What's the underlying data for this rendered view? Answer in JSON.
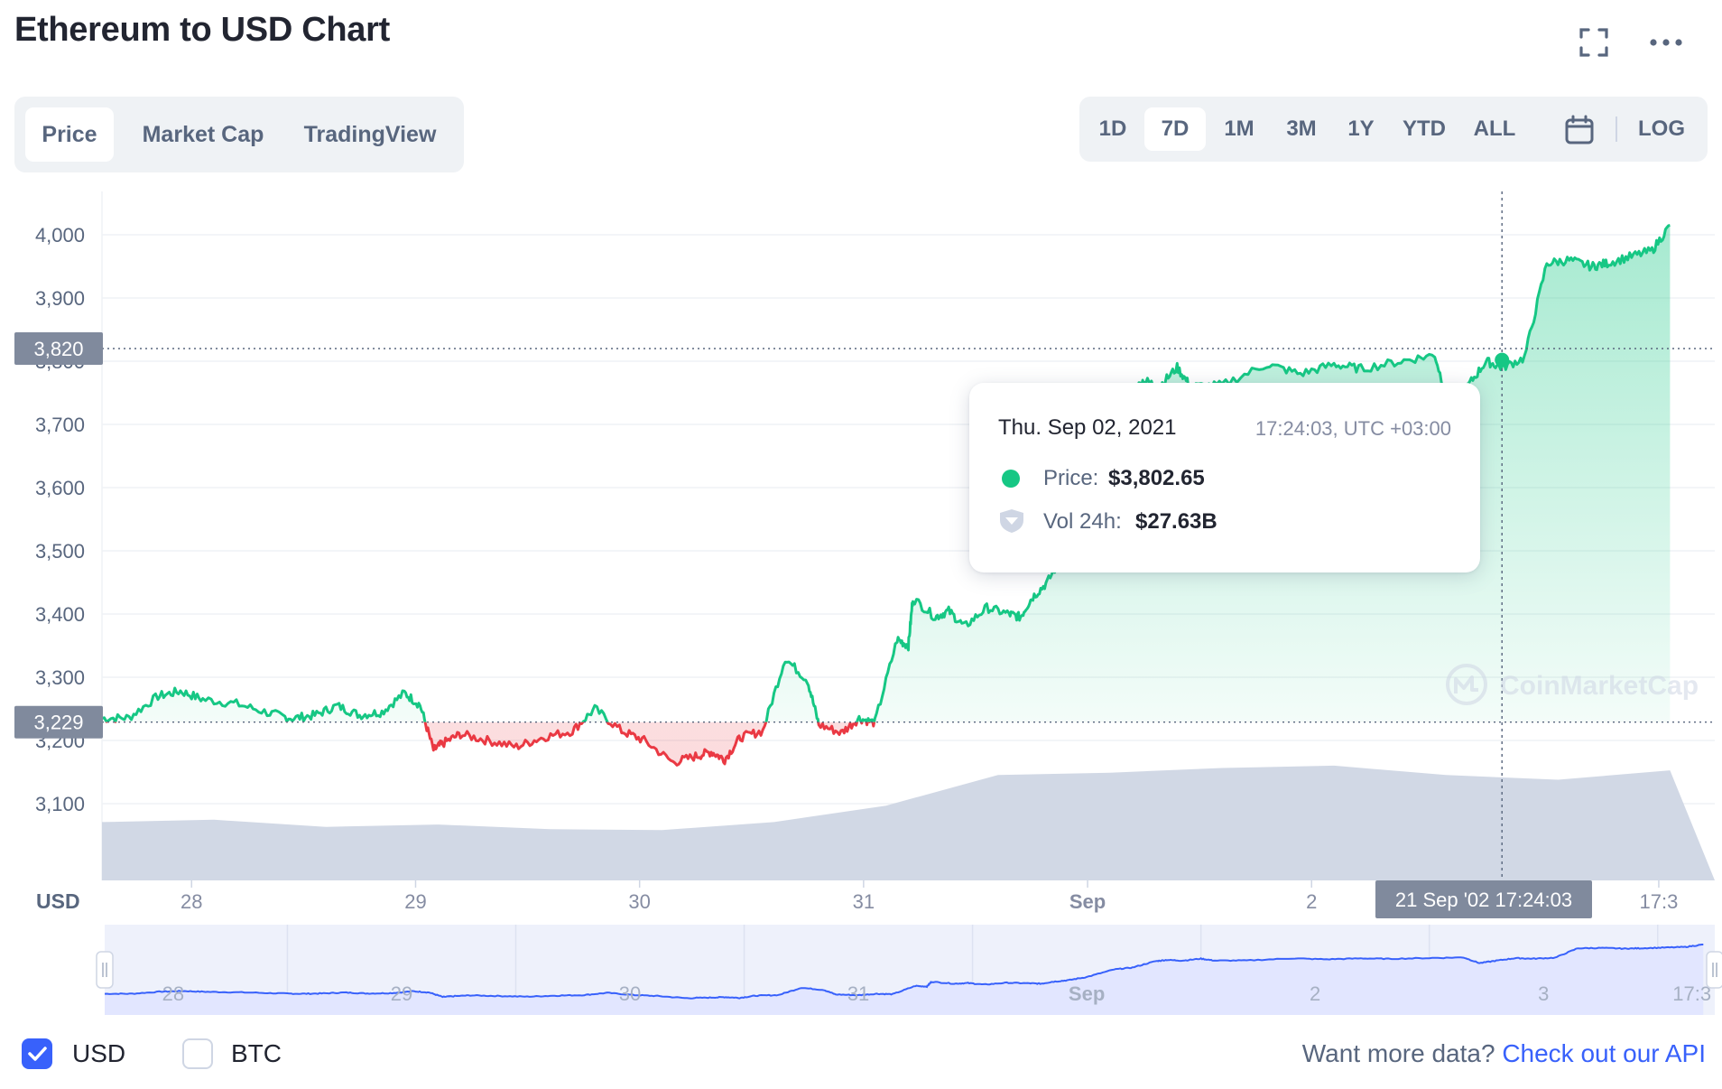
{
  "title": "Ethereum to USD Chart",
  "header_icons": [
    "expand-icon",
    "more-icon"
  ],
  "type_tabs": {
    "items": [
      "Price",
      "Market Cap",
      "TradingView"
    ],
    "active": "Price"
  },
  "range_tabs": {
    "items": [
      "1D",
      "7D",
      "1M",
      "3M",
      "1Y",
      "YTD",
      "ALL"
    ],
    "active": "7D",
    "log_label": "LOG",
    "calendar_icon": "calendar-icon"
  },
  "tooltip": {
    "date": "Thu. Sep 02, 2021",
    "time": "17:24:03, UTC +03:00",
    "price_label": "Price:",
    "price_value": "$3,802.65",
    "vol_label": "Vol 24h:",
    "vol_value": "$27.63B"
  },
  "crosshair_label": "21 Sep '02 17:24:03",
  "price_badges": [
    "3,820",
    "3,229"
  ],
  "watermark": "CoinMarketCap",
  "colors": {
    "up": "#16c784",
    "down": "#ea3943",
    "volume": "#cfd6e4",
    "navigator_line": "#3861fb",
    "navigator_fill": "#e2e6ff",
    "badge": "#808a9d",
    "accent": "#3861fb"
  },
  "chart_data": {
    "type": "line",
    "title": "Ethereum to USD Chart",
    "ylabel": "USD",
    "xlabel": "",
    "yticks": [
      "4,000",
      "3,900",
      "3,800",
      "3,700",
      "3,600",
      "3,500",
      "3,400",
      "3,300",
      "3,200",
      "3,100"
    ],
    "xticks": [
      "28",
      "29",
      "30",
      "31",
      "Sep",
      "2",
      "17:3"
    ],
    "navigator_xticks": [
      "28",
      "29",
      "30",
      "31",
      "Sep",
      "2",
      "3",
      "17:3"
    ],
    "ylim": [
      3000,
      4070
    ],
    "baseline": 3229,
    "x_unit": "days since Aug 27, 2021 17:24",
    "series": [
      {
        "name": "Price",
        "x": [
          0,
          0.12,
          0.25,
          0.35,
          0.45,
          0.6,
          0.75,
          0.85,
          0.95,
          1.05,
          1.15,
          1.25,
          1.35,
          1.42,
          1.48,
          1.52,
          1.6,
          1.72,
          1.85,
          1.97,
          2.1,
          2.2,
          2.32,
          2.42,
          2.55,
          2.65,
          2.72,
          2.78,
          2.85,
          2.95,
          3.05,
          3.15,
          3.2,
          3.3,
          3.38,
          3.45,
          3.55,
          3.6,
          3.62,
          3.72,
          3.78,
          3.85,
          3.95,
          4.05,
          4.1,
          4.15,
          4.22,
          4.3,
          4.42,
          4.5,
          4.6,
          4.65,
          4.72,
          4.8,
          4.86,
          5.0,
          5.2,
          5.35,
          5.5,
          5.62,
          5.8,
          5.95,
          6.02,
          6.1,
          6.18,
          6.25,
          6.35,
          6.45,
          6.55,
          6.65,
          6.72,
          6.82,
          6.92,
          7.0
        ],
        "values": [
          3235,
          3236,
          3270,
          3278,
          3265,
          3258,
          3243,
          3235,
          3240,
          3255,
          3240,
          3245,
          3275,
          3256,
          3185,
          3195,
          3210,
          3200,
          3190,
          3205,
          3215,
          3250,
          3215,
          3200,
          3165,
          3175,
          3182,
          3170,
          3205,
          3215,
          3330,
          3295,
          3225,
          3212,
          3235,
          3228,
          3360,
          3350,
          3425,
          3395,
          3405,
          3380,
          3410,
          3400,
          3395,
          3425,
          3450,
          3500,
          3620,
          3650,
          3750,
          3770,
          3760,
          3790,
          3760,
          3762,
          3795,
          3780,
          3795,
          3788,
          3800,
          3810,
          3720,
          3762,
          3800,
          3790,
          3805,
          3955,
          3960,
          3950,
          3955,
          3965,
          3975,
          4015
        ]
      },
      {
        "name": "Vol 24h",
        "x": [
          0,
          0.5,
          1.0,
          1.5,
          2.0,
          2.5,
          3.0,
          3.5,
          4.0,
          4.5,
          5.0,
          5.5,
          6.0,
          6.5,
          7.0
        ],
        "values": [
          0.95,
          1.0,
          0.85,
          0.9,
          0.8,
          0.78,
          0.95,
          1.3,
          1.95,
          2.0,
          2.1,
          2.15,
          1.95,
          1.85,
          2.05
        ],
        "unit": "relative"
      }
    ]
  },
  "legend": {
    "usd_label": "USD",
    "usd_checked": true,
    "btc_label": "BTC",
    "btc_checked": false
  },
  "api": {
    "prefix": "Want more data?",
    "link_label": "Check out our API"
  }
}
